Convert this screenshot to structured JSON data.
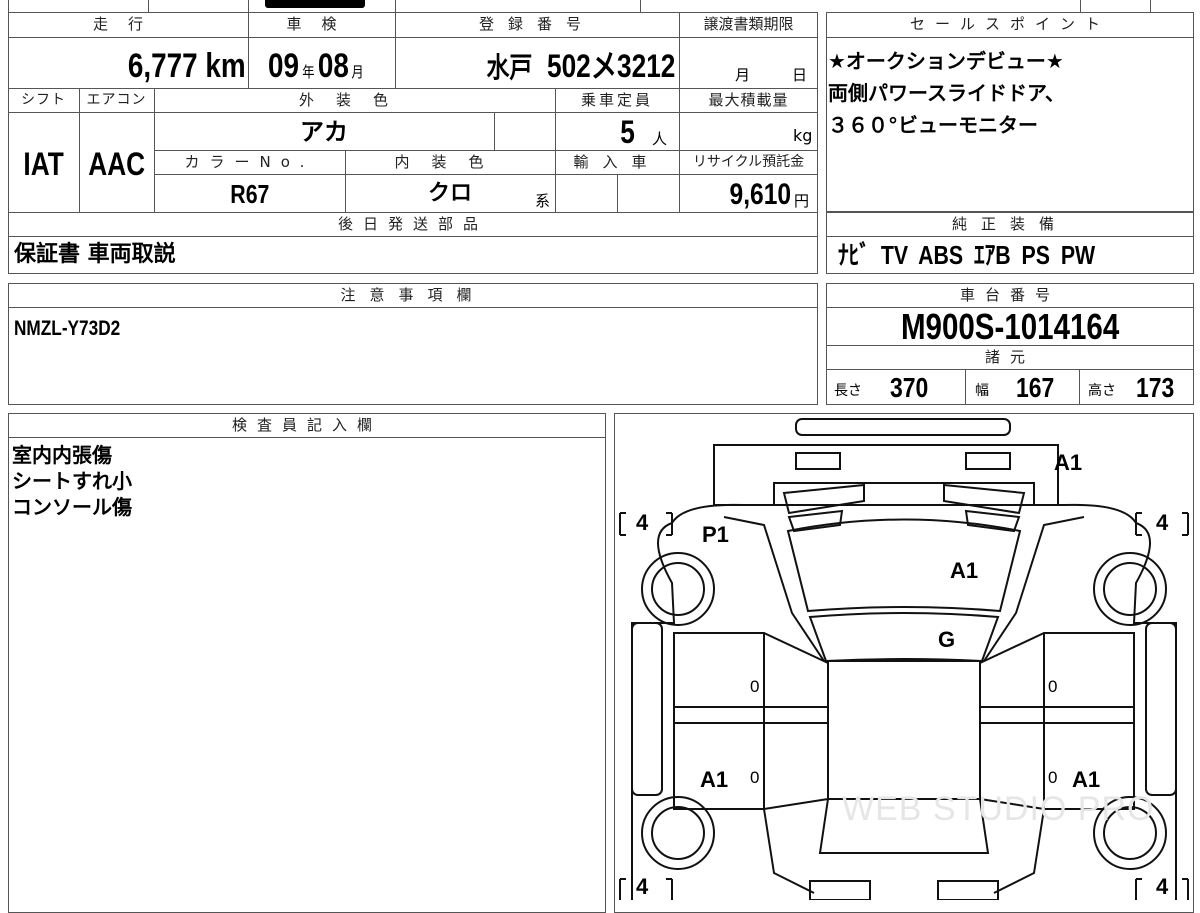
{
  "header": {
    "mileage_label": "走行",
    "inspection_label": "車検",
    "registration_label": "登録番号",
    "transfer_deadline_label": "譲渡書類期限",
    "sales_point_label": "セールスポイント",
    "shift_label": "シフト",
    "aircon_label": "エアコン",
    "exterior_color_label": "外装色",
    "capacity_label": "乗車定員",
    "max_load_label": "最大積載量",
    "color_no_label": "カラーNo.",
    "interior_color_label": "内装色",
    "import_label": "輸入車",
    "recycle_label": "リサイクル預託金",
    "later_parts_label": "後日発送部品",
    "genuine_equipment_label": "純正装備",
    "notes_label": "注意事項欄",
    "chassis_label": "車台番号",
    "specs_label": "諸元",
    "inspector_label": "検査員記入欄"
  },
  "vehicle": {
    "mileage": "6,777",
    "mileage_unit": "km",
    "inspection_year": "09",
    "inspection_year_unit": "年",
    "inspection_month": "08",
    "inspection_month_unit": "月",
    "plate_area": "水戸",
    "plate_number": "502メ3212",
    "deadline_month_unit": "月",
    "deadline_day_unit": "日",
    "shift": "IAT",
    "aircon": "AAC",
    "exterior_color": "アカ",
    "capacity": "5",
    "capacity_unit": "人",
    "max_load_unit": "kg",
    "color_no": "R67",
    "interior_color": "クロ",
    "interior_suffix": "系",
    "recycle_fee": "9,610",
    "recycle_unit": "円",
    "later_parts": "保証書 車両取説",
    "genuine_equipment": "ﾅﾋﾞ TV ABS ｴｱB PS PW",
    "notes": "NMZL-Y73D2",
    "chassis_number": "M900S-1014164",
    "length_label": "長さ",
    "length": "370",
    "width_label": "幅",
    "width": "167",
    "height_label": "高さ",
    "height": "173"
  },
  "sales_points": [
    "★オークションデビュー★",
    "両側パワースライドドア、",
    "３６０°ビューモニター"
  ],
  "inspector_notes": [
    "室内内張傷",
    "シートすれ小",
    "コンソール傷"
  ],
  "diagram": {
    "tire_front_left": "4",
    "tire_front_right": "4",
    "tire_rear_left": "4",
    "tire_rear_right": "4",
    "marks": {
      "rear_bumper": "A1",
      "front_left_fender": "P1",
      "roof": "A1",
      "rear_glass": "G",
      "rear_left_door": "A1",
      "rear_right_door": "A1",
      "zero_front_left": "0",
      "zero_front_right": "0",
      "zero_rear_left": "0",
      "zero_rear_right": "0"
    }
  },
  "watermark": "WEB STUDIO PRO"
}
